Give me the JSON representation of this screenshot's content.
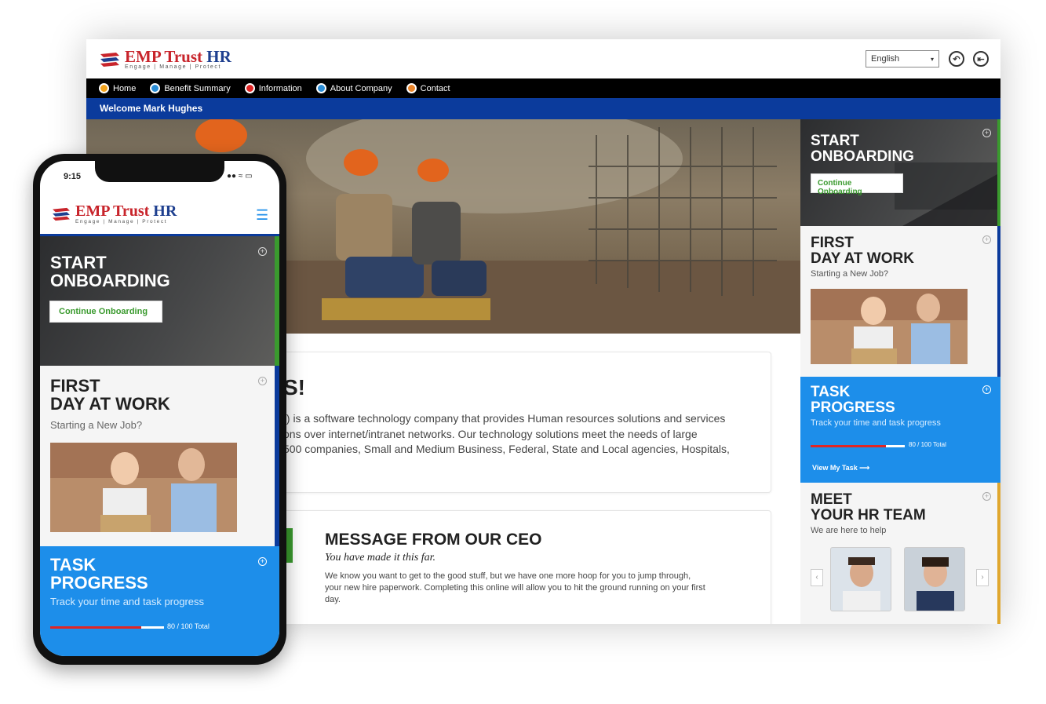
{
  "desktop": {
    "logo": {
      "brand": "EMP Trust",
      "brand_suffix": "HR",
      "tagline": "Engage | Manage | Protect"
    },
    "language": {
      "selected": "English"
    },
    "nav": [
      "Home",
      "Benefit Summary",
      "Information",
      "About Company",
      "Contact"
    ],
    "welcome": "Welcome Mark Hughes",
    "about": {
      "title_partial": "S!",
      "lines": [
        "t) is a software technology company that provides Human resources solutions and services",
        "ons over internet/intranet networks. Our technology solutions meet the needs of large",
        "500 companies, Small and Medium Business, Federal, State and Local agencies, Hospitals,"
      ]
    },
    "ceo": {
      "title": "MESSAGE FROM OUR CEO",
      "subtitle": "You have made it this far.",
      "lines": [
        "We know you want to get to the good stuff, but we have one more hoop for you to jump through,",
        "your new hire paperwork. Completing this online will allow you to hit the ground running on your first",
        "day."
      ]
    },
    "sidebar": {
      "onboarding": {
        "line1": "START",
        "line2": "ONBOARDING",
        "button": "Continue Onboarding"
      },
      "first_day": {
        "line1": "FIRST",
        "line2": "DAY AT WORK",
        "sub": "Starting a New Job?"
      },
      "task": {
        "line1": "TASK",
        "line2": "PROGRESS",
        "sub": "Track your time and task progress",
        "progress_label": "80 / 100 Total",
        "progress": 0.8,
        "link": "View My Task"
      },
      "team": {
        "line1": "MEET",
        "line2": "YOUR HR TEAM",
        "sub": "We are here to help"
      }
    }
  },
  "mobile": {
    "time": "9:15",
    "logo": {
      "brand": "EMP Trust",
      "brand_suffix": "HR",
      "tagline": "Engage | Manage | Protect"
    },
    "onboarding": {
      "line1": "START",
      "line2": "ONBOARDING",
      "button": "Continue Onboarding"
    },
    "first_day": {
      "line1": "FIRST",
      "line2": "DAY AT WORK",
      "sub": "Starting a New Job?"
    },
    "task": {
      "line1": "TASK",
      "line2": "PROGRESS",
      "sub": "Track your time and task progress",
      "progress_label": "80 / 100 Total",
      "progress": 0.8
    }
  },
  "colors": {
    "brand_blue": "#0b3b9c",
    "brand_red": "#c8242b",
    "accent_green": "#3a9a2e",
    "task_blue": "#1d8eea"
  }
}
